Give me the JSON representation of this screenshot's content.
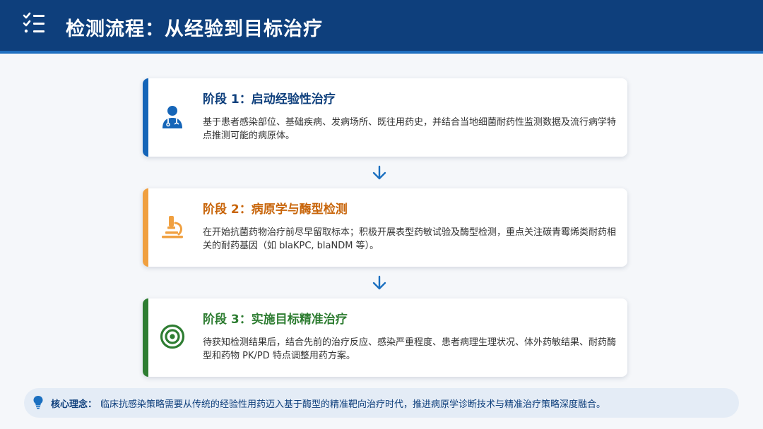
{
  "header": {
    "title": "检测流程：从经验到目标治疗",
    "icon": "checklist-icon"
  },
  "stages": [
    {
      "title": "阶段 1：启动经验性治疗",
      "body": "基于患者感染部位、基础疾病、发病场所、既往用药史，并结合当地细菌耐药性监测数据及流行病学特点推测可能的病原体。",
      "icon": "doctor-icon",
      "color": "#1565b8"
    },
    {
      "title": "阶段 2：病原学与酶型检测",
      "body": "在开始抗菌药物治疗前尽早留取标本；积极开展表型药敏试验及酶型检测，重点关注碳青霉烯类耐药相关的耐药基因（如 blaKPC, blaNDM 等）。",
      "icon": "microscope-icon",
      "color": "#f0a040",
      "title_color": "#c8650a"
    },
    {
      "title": "阶段 3：实施目标精准治疗",
      "body": "待获知检测结果后，结合先前的治疗反应、感染严重程度、患者病理生理状况、体外药敏结果、耐药酶型和药物 PK/PD 特点调整用药方案。",
      "icon": "target-icon",
      "color": "#2e7d32"
    }
  ],
  "arrows": {
    "icon": "arrow-down-icon",
    "color": "#1a6fc0"
  },
  "banner": {
    "icon": "lightbulb-icon",
    "label": "核心理念：",
    "text": "临床抗感染策略需要从传统的经验性用药迈入基于酶型的精准靶向治疗时代，推进病原学诊断技术与精准治疗策略深度融合。"
  }
}
